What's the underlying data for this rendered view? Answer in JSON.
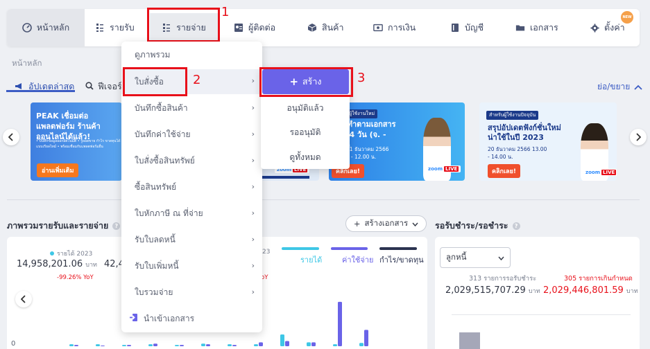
{
  "nav": {
    "items": [
      {
        "label": "หน้าหลัก",
        "icon": "dashboard-icon"
      },
      {
        "label": "รายรับ",
        "icon": "receipt-icon"
      },
      {
        "label": "รายจ่าย",
        "icon": "receipt-icon"
      },
      {
        "label": "ผู้ติดต่อ",
        "icon": "contact-icon"
      },
      {
        "label": "สินค้า",
        "icon": "box-icon"
      },
      {
        "label": "การเงิน",
        "icon": "money-icon"
      },
      {
        "label": "บัญชี",
        "icon": "book-icon"
      },
      {
        "label": "เอกสาร",
        "icon": "folder-icon"
      },
      {
        "label": "ตั้งค่า",
        "icon": "gear-icon"
      }
    ],
    "new_badge": "NEW"
  },
  "annotations": {
    "n1": "1",
    "n2": "2",
    "n3": "3"
  },
  "breadcrumb": "หน้าหลัก",
  "tabs": {
    "latest": "อัปเดตล่าสุด",
    "features": "ฟีเจอร์"
  },
  "collapse_label": "ย่อ/ขยาย",
  "banners": {
    "b1_title": "PEAK เชื่อมต่อแพลตฟอร์ม ร้านค้าออนไลน์ได้แล้ว!",
    "b1_sub": "• บันทึกข้อมูลออกอัตโนมัติ • รู้ยอดขาย กำไร ขาดทุนได้แบบเรียลไทม์ • พร้อมเชื่อมกับแพลตฟอร์มอื่น",
    "b1_btn": "อ่านเพิ่มเติม",
    "b3_tag": "สำหรับผู้ใช้งานใหม่",
    "b3_title": "การทำตามเอกสารจริง 4 วัน (จ. - พฤ.)",
    "b3_date": "18 - 21 ธันวาคม 2566 10.00 - 12.00 น.",
    "b3_btn": "คลิกเลย!",
    "b4_tag": "สำหรับผู้ใช้งานปัจจุบัน",
    "b4_title": "สรุปอัปเดตฟังก์ชั่นใหม่ น่าใช้ในปี 2023",
    "b4_date": "20 ธันวาคม 2566 13.00 - 14.00 น.",
    "b4_btn": "คลิกเลย!",
    "zoom": "zoom",
    "live": "LIVE"
  },
  "overview": {
    "title": "ภาพรวมรายรับและรายจ่าย",
    "create_doc": "สร้างเอกสาร",
    "income_label": "รายได้ 2023",
    "income_value": "14,958,201.06",
    "unit": "บาท",
    "income_yoy": "-99.26% YoY",
    "expense_value": "42,4",
    "legend": [
      "รายได้",
      "ค่าใช้จ่าย",
      "กำไร/ขาดทุน"
    ],
    "legend_colors": [
      "#3ec7e6",
      "#6a63e8",
      "#2b3350"
    ],
    "zero_label": "0",
    "partial_year": "23",
    "partial_yoy": "oY"
  },
  "receivable": {
    "title": "รอรับชำระ/รอชำระ",
    "filter": "ลูกหนี้",
    "left_caption": "313 รายการรอรับชำระ",
    "left_value": "2,029,515,707.29",
    "right_caption": "305 รายการเกินกำหนด",
    "right_value": "2,029,446,801.59",
    "unit": "บาท"
  },
  "menu": {
    "items": [
      {
        "label": "ดูภาพรวม",
        "sub": false
      },
      {
        "label": "ใบสั่งซื้อ",
        "sub": true
      },
      {
        "label": "บันทึกซื้อสินค้า",
        "sub": true
      },
      {
        "label": "บันทึกค่าใช้จ่าย",
        "sub": true
      },
      {
        "label": "ใบสั่งซื้อสินทรัพย์",
        "sub": true
      },
      {
        "label": "ซื้อสินทรัพย์",
        "sub": true
      },
      {
        "label": "ใบหักภาษี ณ ที่จ่าย",
        "sub": true
      },
      {
        "label": "รับใบลดหนี้",
        "sub": true
      },
      {
        "label": "รับใบเพิ่มหนี้",
        "sub": true
      },
      {
        "label": "ใบรวมจ่าย",
        "sub": true
      },
      {
        "label": "นำเข้าเอกสาร",
        "sub": false
      }
    ]
  },
  "submenu": {
    "create": "สร้าง",
    "items": [
      "อนุมัติแล้ว",
      "รออนุมัติ",
      "ดูทั้งหมด"
    ]
  },
  "chart_data": {
    "type": "bar",
    "series": [
      {
        "name": "รายได้",
        "values": [
          0.3,
          0.3,
          0.2,
          0.3,
          0.2,
          0.4,
          0.3,
          0.3,
          1.8,
          0.6,
          0.3,
          0.5
        ]
      },
      {
        "name": "ค่าใช้จ่าย",
        "values": [
          0.2,
          0.1,
          0.2,
          0.4,
          0.2,
          0.3,
          0.2,
          0.6,
          0.8,
          0.6,
          6.8,
          2.5
        ]
      }
    ],
    "ylim": [
      0,
      7
    ]
  }
}
